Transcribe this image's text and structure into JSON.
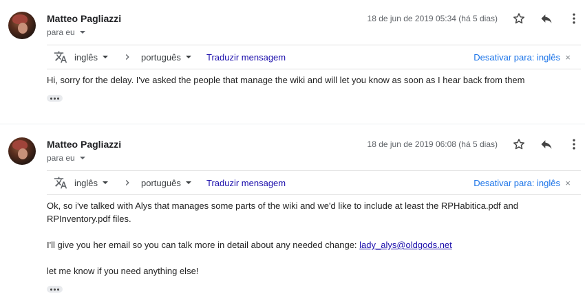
{
  "messages": [
    {
      "sender": "Matteo Pagliazzi",
      "recipient": "para eu",
      "date": "18 de jun de 2019 05:34 (há 5 dias)",
      "translate": {
        "source_lang": "inglês",
        "target_lang": "português",
        "translate_label": "Traduzir mensagem",
        "disable_label": "Desativar para: inglês",
        "close": "×"
      },
      "body": {
        "line1": "Hi, sorry for the delay. I've asked the people that manage the wiki and will let you know as soon as I hear back from them"
      }
    },
    {
      "sender": "Matteo Pagliazzi",
      "recipient": "para eu",
      "date": "18 de jun de 2019 06:08 (há 5 dias)",
      "translate": {
        "source_lang": "inglês",
        "target_lang": "português",
        "translate_label": "Traduzir mensagem",
        "disable_label": "Desativar para: inglês",
        "close": "×"
      },
      "body": {
        "para1_line1": "Ok, so i've talked with Alys that manages some parts of the wiki and we'd like to include at least the RPHabitica.pdf and",
        "para1_line2": "RPInventory.pdf files.",
        "para2_text": "I'll give you her email so you can talk more in detail about any needed change: ",
        "para2_email": "lady_alys@oldgods.net",
        "para3": "let me know if you need anything else!"
      }
    }
  ],
  "icons": {
    "star": "star-outline-icon",
    "reply": "reply-arrow-icon",
    "more": "more-vertical-icon",
    "translate": "translate-icon",
    "arrow": "chevron-right-icon"
  },
  "colors": {
    "link": "#1a0dab",
    "accent_link": "#1a73e8",
    "muted": "#5f6368"
  }
}
